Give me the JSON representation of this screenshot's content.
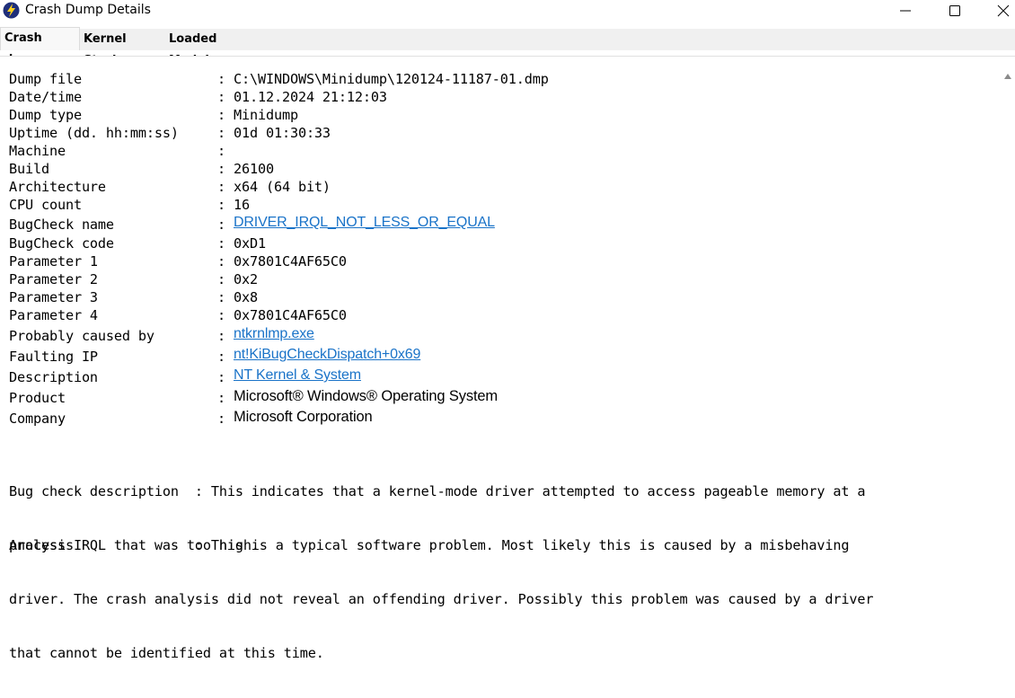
{
  "window": {
    "title": "Crash Dump Details",
    "icon": "lightning-icon"
  },
  "tabs": [
    {
      "label": "Crash dump",
      "active": true
    },
    {
      "label": "Kernel Stack",
      "active": false
    },
    {
      "label": "Loaded Modules",
      "active": false
    }
  ],
  "details": [
    {
      "label": "Dump file",
      "value": "C:\\WINDOWS\\Minidump\\120124-11187-01.dmp",
      "kind": "text"
    },
    {
      "label": "Date/time",
      "value": "01.12.2024 21:12:03",
      "kind": "text"
    },
    {
      "label": "Dump type",
      "value": "Minidump",
      "kind": "text"
    },
    {
      "label": "Uptime (dd. hh:mm:ss)",
      "value": "01d 01:30:33",
      "kind": "text"
    },
    {
      "label": "Machine",
      "value": "",
      "kind": "text"
    },
    {
      "label": "Build",
      "value": "26100",
      "kind": "text"
    },
    {
      "label": "Architecture",
      "value": "x64 (64 bit)",
      "kind": "text"
    },
    {
      "label": "CPU count",
      "value": "16",
      "kind": "text"
    },
    {
      "label": "BugCheck name",
      "value": "DRIVER_IRQL_NOT_LESS_OR_EQUAL",
      "kind": "link"
    },
    {
      "label": "BugCheck code",
      "value": "0xD1",
      "kind": "text"
    },
    {
      "label": "Parameter 1",
      "value": "0x7801C4AF65C0",
      "kind": "text"
    },
    {
      "label": "Parameter 2",
      "value": "0x2",
      "kind": "text"
    },
    {
      "label": "Parameter 3",
      "value": "0x8",
      "kind": "text"
    },
    {
      "label": "Parameter 4",
      "value": "0x7801C4AF65C0",
      "kind": "text"
    },
    {
      "label": "Probably caused by",
      "value": "ntkrnlmp.exe",
      "kind": "link"
    },
    {
      "label": "Faulting IP",
      "value": "nt!KiBugCheckDispatch+0x69",
      "kind": "link"
    },
    {
      "label": "Description",
      "value": "NT Kernel & System",
      "kind": "link"
    },
    {
      "label": "Product",
      "value": "Microsoft® Windows® Operating System",
      "kind": "prop"
    },
    {
      "label": "Company",
      "value": "Microsoft Corporation",
      "kind": "prop"
    }
  ],
  "colon": ":",
  "bug_check_description": {
    "line1": "Bug check description  : This indicates that a kernel-mode driver attempted to access pageable memory at a",
    "line2": "process IRQL that was too high."
  },
  "analysis": {
    "line1": "Analysis               : This is a typical software problem. Most likely this is caused by a misbehaving",
    "line2": "driver. The crash analysis did not reveal an offending driver. Possibly this problem was caused by a driver",
    "line3": "that cannot be identified at this time."
  },
  "colors": {
    "link": "#1a73c8",
    "tabbar_bg": "#f0f0f0"
  }
}
